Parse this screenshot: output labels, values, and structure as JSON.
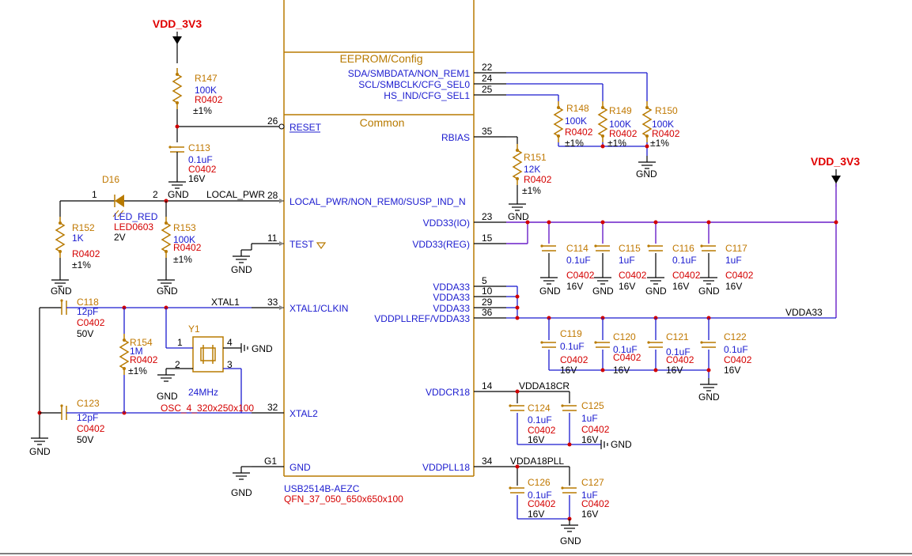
{
  "ic": {
    "part": "USB2514B-AEZC",
    "footprint": "QFN_37_050_650x650x100",
    "section_eeprom": "EEPROM/Config",
    "section_common": "Common",
    "pins": [
      {
        "num": "22",
        "name": "SDA/SMBDATA/NON_REM1"
      },
      {
        "num": "24",
        "name": "SCL/SMBCLK/CFG_SEL0"
      },
      {
        "num": "25",
        "name": "HS_IND/CFG_SEL1"
      },
      {
        "num": "26",
        "name": "RESET"
      },
      {
        "num": "35",
        "name": "RBIAS"
      },
      {
        "num": "28",
        "name": "LOCAL_PWR/NON_REM0/SUSP_IND_N"
      },
      {
        "num": "23",
        "name": "VDD33(IO)"
      },
      {
        "num": "15",
        "name": "VDD33(REG)"
      },
      {
        "num": "11",
        "name": "TEST"
      },
      {
        "num": "5",
        "name": "VDDA33"
      },
      {
        "num": "10",
        "name": "VDDA33"
      },
      {
        "num": "29",
        "name": "VDDA33"
      },
      {
        "num": "36",
        "name": "VDDPLLREF/VDDA33"
      },
      {
        "num": "33",
        "name": "XTAL1/CLKIN"
      },
      {
        "num": "14",
        "name": "VDDCR18"
      },
      {
        "num": "32",
        "name": "XTAL2"
      },
      {
        "num": "G1",
        "name": "GND"
      },
      {
        "num": "34",
        "name": "VDDPLL18"
      }
    ]
  },
  "power": {
    "vdd_left": "VDD_3V3",
    "vdd_right": "VDD_3V3",
    "gnd": "GND",
    "gnd_inline": "GND"
  },
  "nets": {
    "local_pwr": "LOCAL_PWR",
    "xtal1": "XTAL1",
    "vdda33": "VDDA33",
    "vdda18cr": "VDDA18CR",
    "vdda18pll": "VDDA18PLL"
  },
  "parts": {
    "R147": {
      "ref": "R147",
      "val": "100K",
      "pkg": "R0402",
      "tol": "±1%"
    },
    "R148": {
      "ref": "R148",
      "val": "100K",
      "pkg": "R0402",
      "tol": "±1%"
    },
    "R149": {
      "ref": "R149",
      "val": "100K",
      "pkg": "R0402",
      "tol": "±1%"
    },
    "R150": {
      "ref": "R150",
      "val": "100K",
      "pkg": "R0402",
      "tol": "±1%"
    },
    "R151": {
      "ref": "R151",
      "val": "12K",
      "pkg": "R0402",
      "tol": "±1%"
    },
    "R152": {
      "ref": "R152",
      "val": "1K",
      "pkg": "R0402",
      "tol": "±1%"
    },
    "R153": {
      "ref": "R153",
      "val": "100K",
      "pkg": "R0402",
      "tol": "±1%"
    },
    "R154": {
      "ref": "R154",
      "val": "1M",
      "pkg": "R0402",
      "tol": "±1%"
    },
    "C113": {
      "ref": "C113",
      "val": "0.1uF",
      "pkg": "C0402",
      "volt": "16V"
    },
    "C114": {
      "ref": "C114",
      "val": "0.1uF",
      "pkg": "C0402",
      "volt": "16V"
    },
    "C115": {
      "ref": "C115",
      "val": "1uF",
      "pkg": "C0402",
      "volt": "16V"
    },
    "C116": {
      "ref": "C116",
      "val": "0.1uF",
      "pkg": "C0402",
      "volt": "16V"
    },
    "C117": {
      "ref": "C117",
      "val": "1uF",
      "pkg": "C0402",
      "volt": "16V"
    },
    "C118": {
      "ref": "C118",
      "val": "12pF",
      "pkg": "C0402",
      "volt": "50V"
    },
    "C119": {
      "ref": "C119",
      "val": "0.1uF",
      "pkg": "C0402",
      "volt": "16V"
    },
    "C120": {
      "ref": "C120",
      "val": "0.1uF",
      "pkg": "C0402",
      "volt": "16V"
    },
    "C121": {
      "ref": "C121",
      "val": "0.1uF",
      "pkg": "C0402",
      "volt": "16V"
    },
    "C122": {
      "ref": "C122",
      "val": "0.1uF",
      "pkg": "C0402",
      "volt": "16V"
    },
    "C123": {
      "ref": "C123",
      "val": "12pF",
      "pkg": "C0402",
      "volt": "50V"
    },
    "C124": {
      "ref": "C124",
      "val": "0.1uF",
      "pkg": "C0402",
      "volt": "16V"
    },
    "C125": {
      "ref": "C125",
      "val": "1uF",
      "pkg": "C0402",
      "volt": "16V"
    },
    "C126": {
      "ref": "C126",
      "val": "0.1uF",
      "pkg": "C0402",
      "volt": "16V"
    },
    "C127": {
      "ref": "C127",
      "val": "1uF",
      "pkg": "C0402",
      "volt": "16V"
    },
    "D16": {
      "ref": "D16",
      "val": "LED_RED",
      "pkg": "LED0603",
      "volt": "2V",
      "pin1": "1",
      "pin2": "2"
    },
    "Y1": {
      "ref": "Y1",
      "val": "24MHz",
      "pkg": "OSC_4_320x250x100",
      "p1": "1",
      "p2": "2",
      "p3": "3",
      "p4": "4"
    }
  }
}
